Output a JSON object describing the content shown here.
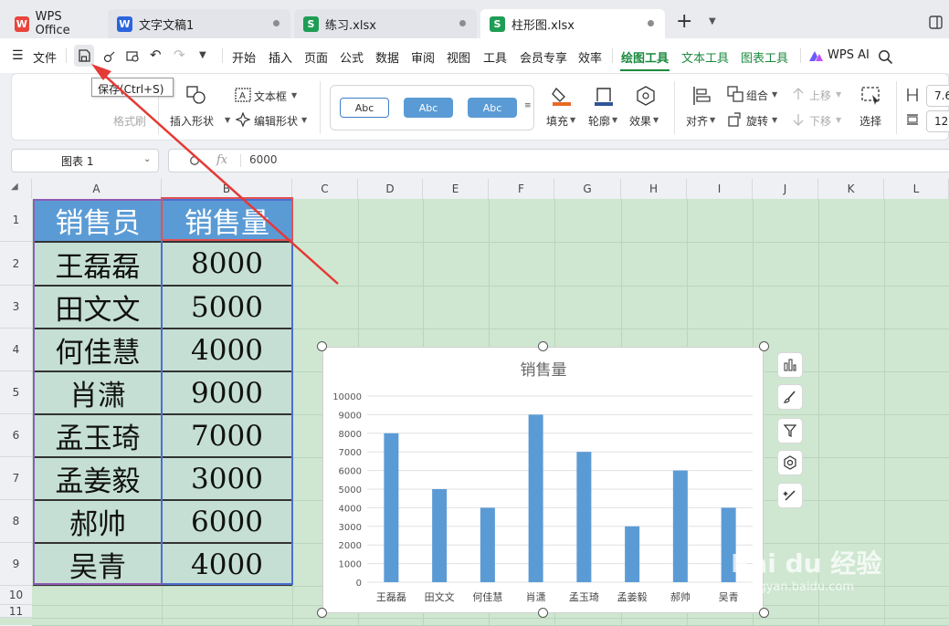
{
  "tabs": [
    {
      "label": "WPS Office",
      "icon": "W",
      "color": "#e8453c"
    },
    {
      "label": "文字文稿1",
      "icon": "W",
      "color": "#2b64dd"
    },
    {
      "label": "练习.xlsx",
      "icon": "S",
      "color": "#1f9d55"
    },
    {
      "label": "柱形图.xlsx",
      "icon": "S",
      "color": "#1f9d55"
    }
  ],
  "new_tab": "+",
  "menu": {
    "file": "文件",
    "items": [
      "开始",
      "插入",
      "页面",
      "公式",
      "数据",
      "审阅",
      "视图",
      "工具",
      "会员专享",
      "效率"
    ],
    "drawing_tools": "绘图工具",
    "text_tools": "文本工具",
    "chart_tools": "图表工具",
    "wps_ai": "WPS AI"
  },
  "tooltip": "保存(Ctrl+S)",
  "ribbon": {
    "format_painter": "格式刷",
    "insert_shape": "插入形状",
    "text_box": "文本框",
    "edit_shape": "编辑形状",
    "style_samples": [
      "Abc",
      "Abc",
      "Abc"
    ],
    "fill": "填充",
    "outline": "轮廓",
    "effect": "效果",
    "align": "对齐",
    "group": "组合",
    "rotate": "旋转",
    "bring_forward": "上移",
    "send_backward": "下移",
    "select": "选择",
    "width": "7.6",
    "height": "12"
  },
  "formula_bar": {
    "name_box": "图表 1",
    "fx": "fx",
    "value": "6000"
  },
  "columns": [
    "A",
    "B",
    "C",
    "D",
    "E",
    "F",
    "G",
    "H",
    "I",
    "J",
    "K",
    "L"
  ],
  "rows": [
    "1",
    "2",
    "3",
    "4",
    "5",
    "6",
    "7",
    "8",
    "9",
    "10",
    "11"
  ],
  "table": {
    "headers": [
      "销售员",
      "销售量"
    ],
    "rows": [
      [
        "王磊磊",
        "8000"
      ],
      [
        "田文文",
        "5000"
      ],
      [
        "何佳慧",
        "4000"
      ],
      [
        "肖潇",
        "9000"
      ],
      [
        "孟玉琦",
        "7000"
      ],
      [
        "孟姜毅",
        "3000"
      ],
      [
        "郝帅",
        "6000"
      ],
      [
        "吴青",
        "4000"
      ]
    ]
  },
  "watermark": {
    "text": "Bai du 经验",
    "url": "jingyan.baidu.com"
  },
  "chart_data": {
    "type": "bar",
    "title": "销售量",
    "categories": [
      "王磊磊",
      "田文文",
      "何佳慧",
      "肖潇",
      "孟玉琦",
      "孟姜毅",
      "郝帅",
      "吴青"
    ],
    "series": [
      {
        "values": [
          8000,
          5000,
          4000,
          9000,
          7000,
          3000,
          6000,
          4000
        ]
      }
    ],
    "yticks": [
      "0",
      "1000",
      "2000",
      "3000",
      "4000",
      "5000",
      "6000",
      "7000",
      "8000",
      "9000",
      "10000"
    ],
    "ylim": [
      0,
      10000
    ],
    "bar_color": "#5b9bd5",
    "grid": true
  }
}
